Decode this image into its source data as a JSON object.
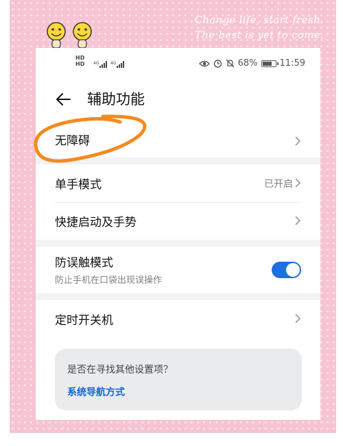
{
  "decoration": {
    "line1": "Change life, start fresh.",
    "line2": "The best is yet to come."
  },
  "status_bar": {
    "network_label_1": "HD",
    "network_label_2": "HD",
    "signal_1": "4G",
    "signal_2": "4G",
    "battery_percent": "68%",
    "time": "11:59"
  },
  "header": {
    "title": "辅助功能"
  },
  "rows": {
    "accessibility": {
      "label": "无障碍"
    },
    "one_hand": {
      "label": "单手模式",
      "value": "已开启"
    },
    "shortcuts": {
      "label": "快捷启动及手势"
    },
    "anti_touch": {
      "label": "防误触模式",
      "sub": "防止手机在口袋出现误操作",
      "enabled": true
    },
    "scheduled_power": {
      "label": "定时开关机"
    }
  },
  "suggestion": {
    "question": "是否在寻找其他设置项？",
    "link": "系统导航方式"
  },
  "colors": {
    "accent": "#1e6fe0",
    "frame_pink": "#f6c4d2",
    "scribble_orange": "#f58a1f"
  }
}
